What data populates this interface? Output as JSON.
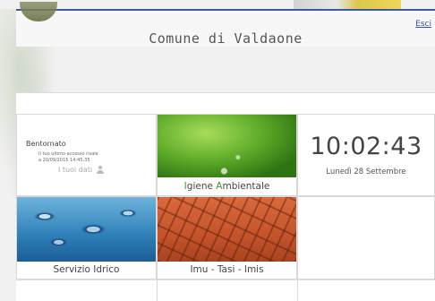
{
  "header": {
    "title": "Comune di Valdaone",
    "exit_link": "Esci"
  },
  "welcome": {
    "title": "Bentornato",
    "last_access_line1": "Il tuo ultimo accesso risale",
    "last_access_line2": "a 20/09/2015 14:45:35",
    "my_data_link": "I tuoi dati"
  },
  "tiles": {
    "igiene": {
      "label_prefix": "I",
      "label_mid": "giene ",
      "label_hl": "A",
      "label_rest": "mbientale"
    },
    "idrico": {
      "label": "Servizio Idrico"
    },
    "imu": {
      "label": "Imu - Tasi - Imis"
    }
  },
  "clock": {
    "time": "10:02:43",
    "date": "Lunedì 28 Settembre"
  },
  "colors": {
    "header_line": "#3b5aa3",
    "link": "#3355aa",
    "igiene_accent": "#3e9a2a"
  }
}
